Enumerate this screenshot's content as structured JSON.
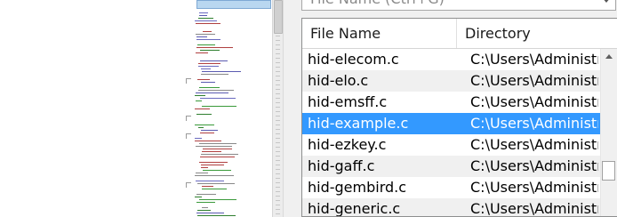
{
  "search": {
    "placeholder": "File Name (Ctrl+G)"
  },
  "list": {
    "columns": [
      "File Name",
      "Directory"
    ],
    "rows": [
      {
        "name": "hid-elecom.c",
        "dir": "C:\\Users\\Administra"
      },
      {
        "name": "hid-elo.c",
        "dir": "C:\\Users\\Administra"
      },
      {
        "name": "hid-emsff.c",
        "dir": "C:\\Users\\Administra"
      },
      {
        "name": "hid-example.c",
        "dir": "C:\\Users\\Administra"
      },
      {
        "name": "hid-ezkey.c",
        "dir": "C:\\Users\\Administra"
      },
      {
        "name": "hid-gaff.c",
        "dir": "C:\\Users\\Administra"
      },
      {
        "name": "hid-gembird.c",
        "dir": "C:\\Users\\Administra"
      },
      {
        "name": "hid-generic.c",
        "dir": "C:\\Users\\Administra"
      }
    ],
    "selected_index": 3
  },
  "colors": {
    "selection": "#3399ff",
    "minimap_highlight": "#b9d7f0"
  }
}
